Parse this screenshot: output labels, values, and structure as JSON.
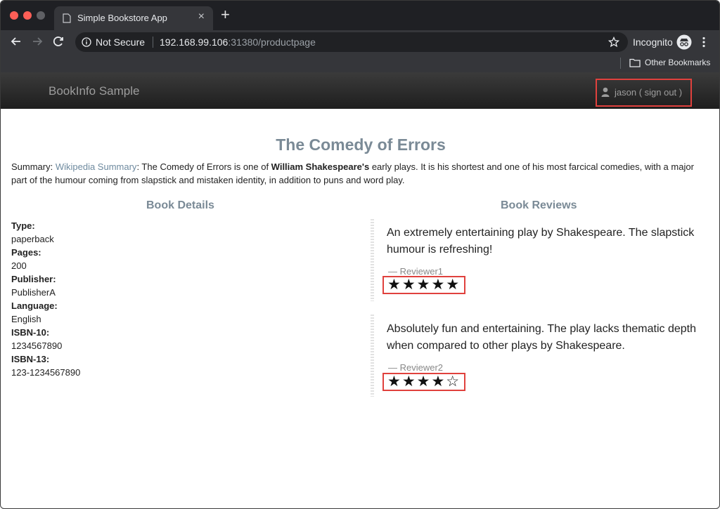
{
  "browser": {
    "tab_title": "Simple Bookstore App",
    "tab_close_glyph": "×",
    "new_tab_glyph": "+",
    "security_label": "Not Secure",
    "url_host": "192.168.99.106",
    "url_rest": ":31380/productpage",
    "incognito_label": "Incognito",
    "other_bookmarks": "Other Bookmarks"
  },
  "app": {
    "brand": "BookInfo Sample",
    "user": {
      "name": "jason",
      "open_paren": " ( ",
      "sign_out_label": "sign out",
      "close_paren": " )"
    }
  },
  "book": {
    "title": "The Comedy of Errors",
    "summary": {
      "prefix": "Summary: ",
      "link": "Wikipedia Summary",
      "text_before": ": The Comedy of Errors is one of ",
      "bold": "William Shakespeare's",
      "text_after": " early plays. It is his shortest and one of his most farcical comedies, with a major part of the humour coming from slapstick and mistaken identity, in addition to puns and word play."
    }
  },
  "details": {
    "heading": "Book Details",
    "fields": [
      {
        "label": "Type:",
        "value": "paperback"
      },
      {
        "label": "Pages:",
        "value": "200"
      },
      {
        "label": "Publisher:",
        "value": "PublisherA"
      },
      {
        "label": "Language:",
        "value": "English"
      },
      {
        "label": "ISBN-10:",
        "value": "1234567890"
      },
      {
        "label": "ISBN-13:",
        "value": "123-1234567890"
      }
    ]
  },
  "reviews": {
    "heading": "Book Reviews",
    "items": [
      {
        "text": "An extremely entertaining play by Shakespeare. The slapstick humour is refreshing!",
        "reviewer": "— Reviewer1",
        "rating": 5,
        "stars": "★★★★★"
      },
      {
        "text": "Absolutely fun and entertaining. The play lacks thematic depth when compared to other plays by Shakespeare.",
        "reviewer": "— Reviewer2",
        "rating": 4,
        "stars": "★★★★☆"
      }
    ]
  },
  "colors": {
    "highlight": "#e0413d",
    "heading": "#7a8a96",
    "link": "#6e8a9f",
    "navbar": "#222222"
  }
}
